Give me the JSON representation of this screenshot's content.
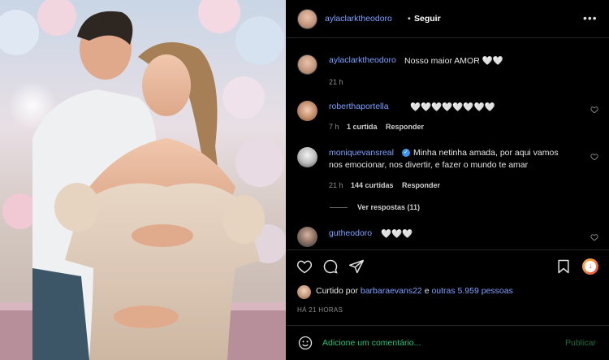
{
  "header": {
    "username": "aylaclarktheodoro",
    "separator": "•",
    "follow_label": "Seguir",
    "more_icon": "more-horizontal-icon"
  },
  "caption": {
    "username": "aylaclarktheodoro",
    "text": "Nosso maior AMOR 🤍🤍",
    "time": "21 h"
  },
  "comments": [
    {
      "username": "roberthaportella",
      "verified": false,
      "text": "🤍🤍🤍🤍🤍🤍🤍🤍",
      "time": "7 h",
      "likes": "1 curtida",
      "reply": "Responder"
    },
    {
      "username": "moniquevansreal",
      "verified": true,
      "text_line1": "Minha netinha amada, por aqui vamos",
      "text_line2": "nos emocionar, nos divertir, e fazer o mundo te amar",
      "time": "21 h",
      "likes": "144 curtidas",
      "reply": "Responder",
      "view_replies": "Ver respostas (11)"
    },
    {
      "username": "gutheodoro",
      "verified": false,
      "text": "🤍🤍🤍"
    }
  ],
  "actions": {
    "like_icon": "heart-icon",
    "comment_icon": "comment-icon",
    "share_icon": "share-icon",
    "save_icon": "bookmark-icon",
    "extra_icon": "download-badge-icon"
  },
  "likes": {
    "prefix": "Curtido por",
    "user": "barbaraevans22",
    "conjunction": "e",
    "others": "outras 5.959 pessoas"
  },
  "timestamp": "HÁ 21 HORAS",
  "comment_box": {
    "emoji_icon": "emoji-icon",
    "placeholder": "Adicione um comentário...",
    "publish_label": "Publicar"
  },
  "colors": {
    "background": "#000000",
    "username": "#7fa0ff",
    "comment_input": "#24c27a",
    "verified": "#3897f0"
  }
}
